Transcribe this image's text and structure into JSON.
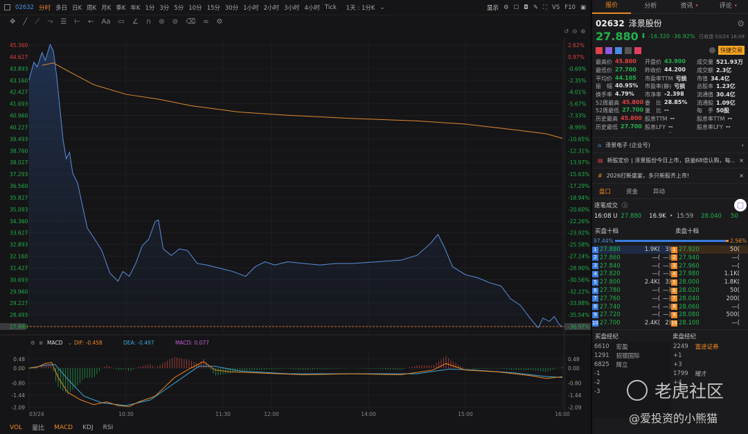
{
  "topbar": {
    "code": "02632",
    "periods": [
      "分时",
      "多日",
      "日K",
      "周K",
      "月K",
      "季K",
      "年K",
      "1分",
      "3分",
      "5分",
      "10分",
      "15分",
      "30分",
      "1小时",
      "2小时",
      "3小时",
      "4小时",
      "Tick"
    ],
    "active": "分时",
    "range": "1天 : 1分K",
    "display": "显示",
    "vs": "VS",
    "f10": "F10"
  },
  "drawtools": [
    "move-icon",
    "line-icon",
    "polyline-icon",
    "path-icon",
    "fib-icon",
    "measure-icon",
    "arrow-icon",
    "Aa",
    "comment-icon",
    "angle-icon",
    "magnet-icon",
    "lock-icon",
    "eye-off-icon",
    "trash-icon",
    "link-icon",
    "settings-icon"
  ],
  "price_axis": [
    "45.360",
    "44.627",
    "43.893",
    "43.160",
    "42.427",
    "41.693",
    "40.960",
    "40.227",
    "39.493",
    "38.760",
    "38.027",
    "37.293",
    "36.560",
    "35.827",
    "35.093",
    "34.360",
    "33.627",
    "32.893",
    "32.160",
    "31.427",
    "30.693",
    "29.960",
    "29.227",
    "28.493",
    "27.880"
  ],
  "pct_axis": [
    "2.62%",
    "0.97%",
    "-0.69%",
    "-2.35%",
    "-4.01%",
    "-5.67%",
    "-7.33%",
    "-8.99%",
    "-10.65%",
    "-12.31%",
    "-13.97%",
    "-15.63%",
    "-17.29%",
    "-18.94%",
    "-20.60%",
    "-22.26%",
    "-23.92%",
    "-25.58%",
    "-27.24%",
    "-28.90%",
    "-30.56%",
    "-32.22%",
    "-33.88%",
    "-35.54%",
    "-36.97%"
  ],
  "time_axis": [
    {
      "label": "03/24",
      "m": 0
    },
    {
      "label": "10:30",
      "m": 60
    },
    {
      "label": "11:30",
      "m": 120
    },
    {
      "label": "12:00",
      "m": 150
    },
    {
      "label": "14:00",
      "m": 210
    },
    {
      "label": "15:00",
      "m": 270
    },
    {
      "label": "16:00",
      "m": 330
    }
  ],
  "price_series": [
    [
      0,
      43.2
    ],
    [
      3,
      44.3
    ],
    [
      5,
      44.0
    ],
    [
      8,
      44.9
    ],
    [
      10,
      44.4
    ],
    [
      13,
      45.4
    ],
    [
      15,
      45.0
    ],
    [
      17,
      43.5
    ],
    [
      19,
      41.5
    ],
    [
      21,
      39.5
    ],
    [
      23,
      38.3
    ],
    [
      25,
      38.7
    ],
    [
      27,
      37.4
    ],
    [
      30,
      36.8
    ],
    [
      33,
      35.4
    ],
    [
      36,
      34.0
    ],
    [
      40,
      33.4
    ],
    [
      45,
      32.6
    ],
    [
      50,
      31.2
    ],
    [
      55,
      30.7
    ],
    [
      58,
      31.3
    ],
    [
      62,
      31.0
    ],
    [
      66,
      31.8
    ],
    [
      70,
      32.9
    ],
    [
      74,
      33.3
    ],
    [
      78,
      34.4
    ],
    [
      80,
      34.5
    ],
    [
      83,
      32.7
    ],
    [
      88,
      32.3
    ],
    [
      93,
      32.7
    ],
    [
      98,
      32.6
    ],
    [
      104,
      31.8
    ],
    [
      110,
      31.7
    ],
    [
      118,
      31.5
    ],
    [
      126,
      31.3
    ],
    [
      134,
      31.0
    ],
    [
      140,
      31.6
    ],
    [
      146,
      31.9
    ],
    [
      152,
      31.7
    ],
    [
      160,
      31.9
    ],
    [
      170,
      31.8
    ],
    [
      180,
      31.7
    ],
    [
      190,
      31.8
    ],
    [
      200,
      31.8
    ],
    [
      215,
      31.9
    ],
    [
      230,
      32.0
    ],
    [
      240,
      32.3
    ],
    [
      248,
      33.0
    ],
    [
      253,
      33.6
    ],
    [
      257,
      32.8
    ],
    [
      262,
      31.6
    ],
    [
      270,
      31.1
    ],
    [
      278,
      30.9
    ],
    [
      285,
      30.6
    ],
    [
      292,
      30.4
    ],
    [
      298,
      29.6
    ],
    [
      304,
      29.2
    ],
    [
      310,
      28.4
    ],
    [
      315,
      27.8
    ],
    [
      318,
      28.4
    ],
    [
      322,
      28.2
    ],
    [
      325,
      28.5
    ],
    [
      328,
      28.0
    ],
    [
      330,
      27.88
    ]
  ],
  "avg_series": [
    [
      8,
      44.1
    ],
    [
      15,
      44.25
    ],
    [
      25,
      43.7
    ],
    [
      40,
      42.9
    ],
    [
      60,
      42.3
    ],
    [
      80,
      42.0
    ],
    [
      100,
      41.6
    ],
    [
      130,
      41.2
    ],
    [
      160,
      41.0
    ],
    [
      200,
      40.8
    ],
    [
      240,
      40.65
    ],
    [
      270,
      40.45
    ],
    [
      300,
      40.1
    ],
    [
      320,
      39.85
    ],
    [
      330,
      39.57
    ]
  ],
  "price_range": [
    27.88,
    45.36
  ],
  "macd": {
    "label": "MACD",
    "dif_label": "DIF: -0.458",
    "dea_label": "DEA: -0.497",
    "macd_label": "MACD: 0.077",
    "axis": [
      "0.48",
      "0.00",
      "-0.80",
      "-1.44",
      "-2.09"
    ],
    "dif": [
      [
        0,
        0
      ],
      [
        5,
        0.05
      ],
      [
        10,
        0.25
      ],
      [
        14,
        0.3
      ],
      [
        18,
        -0.5
      ],
      [
        24,
        -1.3
      ],
      [
        32,
        -1.7
      ],
      [
        40,
        -1.95
      ],
      [
        48,
        -1.8
      ],
      [
        55,
        -2.0
      ],
      [
        62,
        -2.05
      ],
      [
        68,
        -1.8
      ],
      [
        78,
        -1.5
      ],
      [
        90,
        -0.5
      ],
      [
        100,
        0.0
      ],
      [
        108,
        0.35
      ],
      [
        115,
        -0.1
      ],
      [
        125,
        -0.2
      ],
      [
        140,
        -0.25
      ],
      [
        170,
        -0.35
      ],
      [
        200,
        -0.3
      ],
      [
        230,
        -0.35
      ],
      [
        250,
        -0.1
      ],
      [
        258,
        0.25
      ],
      [
        270,
        -0.1
      ],
      [
        290,
        -0.2
      ],
      [
        310,
        -0.4
      ],
      [
        320,
        -0.55
      ],
      [
        330,
        -0.46
      ]
    ],
    "dea": [
      [
        0,
        0
      ],
      [
        10,
        0.15
      ],
      [
        16,
        0.2
      ],
      [
        24,
        -0.6
      ],
      [
        34,
        -1.5
      ],
      [
        45,
        -1.85
      ],
      [
        60,
        -2.0
      ],
      [
        75,
        -1.7
      ],
      [
        90,
        -0.8
      ],
      [
        105,
        0.1
      ],
      [
        115,
        0.1
      ],
      [
        130,
        -0.15
      ],
      [
        160,
        -0.3
      ],
      [
        200,
        -0.3
      ],
      [
        240,
        -0.3
      ],
      [
        260,
        -0.05
      ],
      [
        275,
        -0.1
      ],
      [
        300,
        -0.25
      ],
      [
        320,
        -0.45
      ],
      [
        330,
        -0.5
      ]
    ]
  },
  "bottom_tabs": [
    "VOL",
    "量比",
    "MACD",
    "KDJ",
    "RSI"
  ],
  "right": {
    "tabs": [
      "报价",
      "分析",
      "资讯",
      "评论"
    ],
    "code": "02632",
    "name": "泽景股份",
    "price": "27.880",
    "change": "-16.320",
    "change_pct": "-36.92%",
    "status": "已收盘 03/24 16:09",
    "quick_trade": "快捷交易",
    "stats": [
      [
        [
          "最高价",
          "45.800",
          "red"
        ],
        [
          "开盘价",
          "43.900",
          "green"
        ],
        [
          "成交量",
          "521.93万",
          "white"
        ]
      ],
      [
        [
          "最低价",
          "27.700",
          "green"
        ],
        [
          "昨收价",
          "44.200",
          "white"
        ],
        [
          "成交额",
          "2.3亿",
          "white"
        ]
      ],
      [
        [
          "平均价",
          "44.105",
          "green"
        ],
        [
          "市盈率TTM",
          "亏损",
          "white"
        ],
        [
          "市值",
          "34.4亿",
          "white"
        ]
      ],
      [
        [
          "振　幅",
          "40.95%",
          "white"
        ],
        [
          "市盈率(静)",
          "亏损",
          "white"
        ],
        [
          "总股本",
          "1.23亿",
          "white"
        ]
      ],
      [
        [
          "换手率",
          "4.79%",
          "white"
        ],
        [
          "市净率",
          "-2.398",
          "white"
        ],
        [
          "流通值",
          "30.4亿",
          "white"
        ]
      ],
      [
        [
          "52周最高",
          "45.800",
          "red"
        ],
        [
          "委　比",
          "28.85%",
          "white"
        ],
        [
          "流通股",
          "1.09亿",
          "white"
        ]
      ],
      [
        [
          "52周最低",
          "27.700",
          "green"
        ],
        [
          "量　比",
          "--",
          "white"
        ],
        [
          "每　手",
          "50股",
          "white"
        ]
      ],
      [
        [
          "历史最高",
          "45.800",
          "red"
        ],
        [
          "股息TTM",
          "--",
          "white"
        ],
        [
          "股息率TTM",
          "--",
          "white"
        ]
      ],
      [
        [
          "历史最低",
          "27.700",
          "green"
        ],
        [
          "股息LFY",
          "--",
          "white"
        ],
        [
          "股息率LFY",
          "--",
          "white"
        ]
      ]
    ],
    "news": [
      "泽景电子 (企业号)",
      "新股定价 | 泽景股份今日上市，获逾68倍认购，每...",
      "2026打新盛宴，多只新股齐上市!"
    ],
    "subtabs": [
      "盘口",
      "资金",
      "异动"
    ],
    "ticks_title": "逐笔成交",
    "tick": {
      "time": "16:08 U",
      "price": "27.880",
      "vol": "16.9K",
      "time2": "15:59",
      "price2": "28.040",
      "vol2": "50"
    },
    "bid_title": "买盘十档",
    "ask_title": "卖盘十档",
    "bid_pct": "97.44%",
    "ask_pct": "2.56%",
    "bid_ratio": 0.9744,
    "bids": [
      [
        "27.880",
        "1.9K(",
        "3)"
      ],
      [
        "27.860",
        "—(",
        "—)"
      ],
      [
        "27.840",
        "—(",
        "—)"
      ],
      [
        "27.820",
        "—(",
        "—)"
      ],
      [
        "27.800",
        "2.4K(",
        "3)"
      ],
      [
        "27.780",
        "—(",
        "—)"
      ],
      [
        "27.760",
        "—(",
        "—)"
      ],
      [
        "27.740",
        "—(",
        "—)"
      ],
      [
        "27.720",
        "—(",
        "—)"
      ],
      [
        "27.700",
        "2.4K(",
        "2)"
      ]
    ],
    "asks": [
      [
        "27.920",
        "50("
      ],
      [
        "27.940",
        "—("
      ],
      [
        "27.960",
        "—("
      ],
      [
        "27.980",
        "1.1K("
      ],
      [
        "28.000",
        "1.8K("
      ],
      [
        "28.020",
        "50("
      ],
      [
        "28.040",
        "200("
      ],
      [
        "28.060",
        "—("
      ],
      [
        "28.080",
        "500("
      ],
      [
        "28.100",
        "—("
      ]
    ],
    "buy_broker_title": "买盘经纪",
    "sell_broker_title": "卖盘经纪",
    "buy_brokers": [
      [
        "6610",
        "宏盈"
      ],
      [
        "1291",
        "招银国际"
      ],
      [
        "6825",
        "辉立"
      ],
      [
        "-1",
        ""
      ],
      [
        "-2",
        ""
      ],
      [
        "-3",
        ""
      ]
    ],
    "sell_brokers": [
      [
        "2249",
        "富途证券"
      ],
      [
        "+1",
        ""
      ],
      [
        "+3",
        ""
      ],
      [
        "1799",
        "耀才"
      ],
      [
        "+4",
        ""
      ]
    ],
    "watermark": "老虎社区",
    "watermark_user": "@爱投资的小熊猫"
  }
}
